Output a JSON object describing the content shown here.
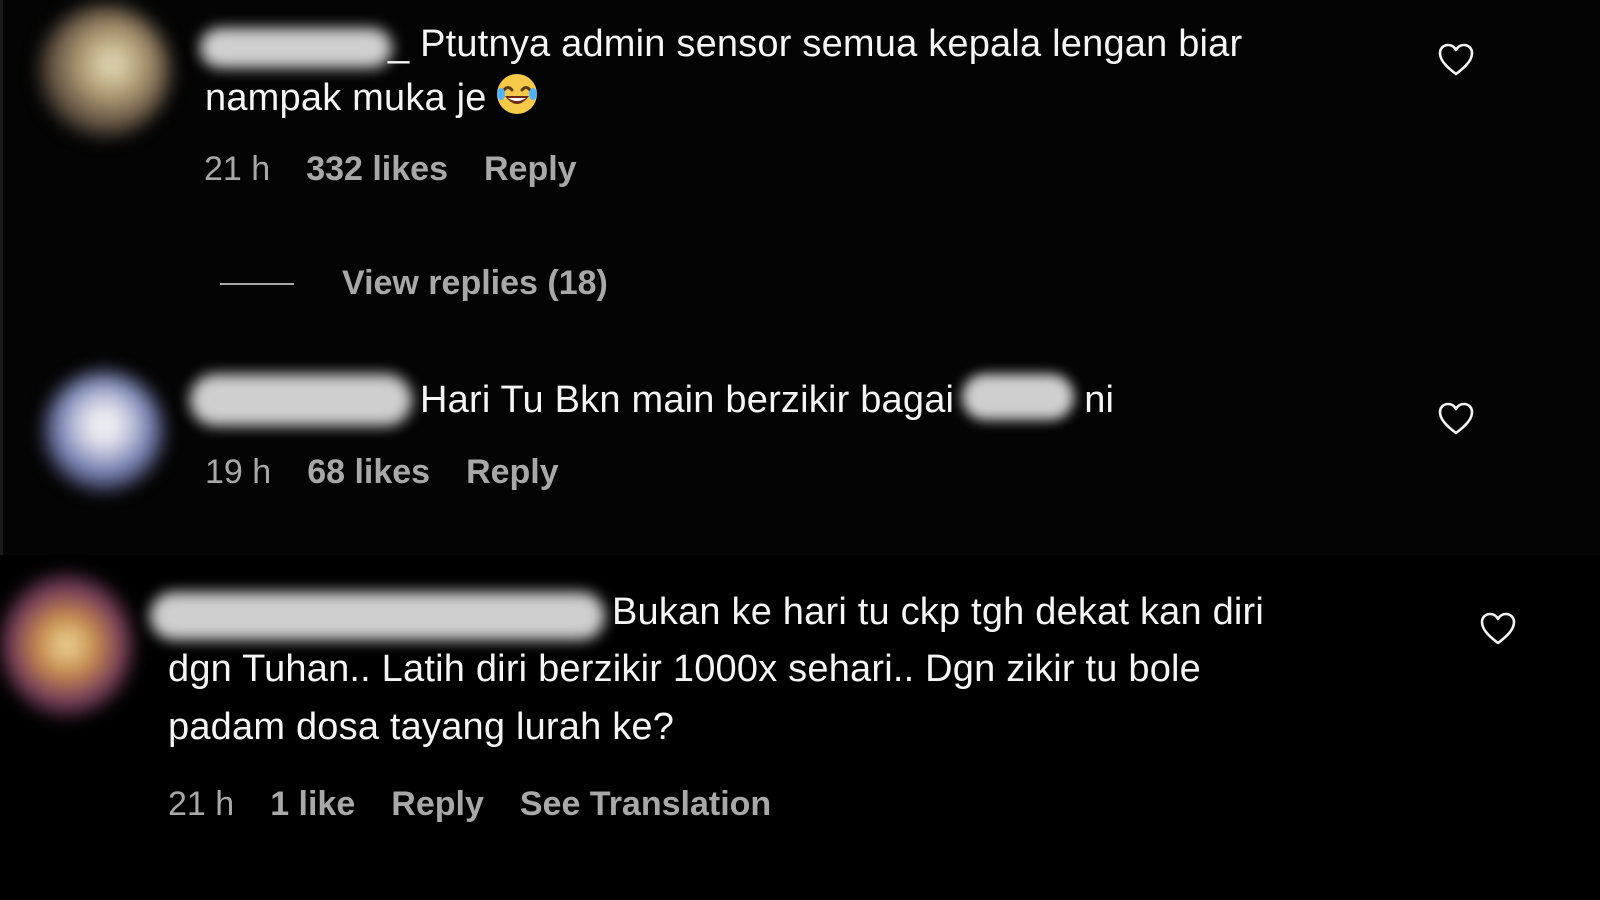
{
  "comments": [
    {
      "text_line1": "_ Ptutnya admin sensor semua kepala lengan biar",
      "text_line2": "nampak muka je",
      "emoji": "laughing-tears-emoji",
      "time": "21 h",
      "likes": "332 likes",
      "reply": "Reply",
      "view_replies": "View replies (18)",
      "heart_icon": "heart-outline-icon"
    },
    {
      "text_before": "Hari Tu Bkn main berzikir bagai",
      "text_after": "ni",
      "time": "19 h",
      "likes": "68 likes",
      "reply": "Reply",
      "heart_icon": "heart-outline-icon"
    },
    {
      "text_line1": "Bukan ke hari tu ckp tgh dekat kan diri",
      "text_line2": "dgn Tuhan.. Latih diri berzikir 1000x sehari.. Dgn zikir tu bole",
      "text_line3": "padam dosa tayang lurah ke?",
      "time": "21 h",
      "likes": "1 like",
      "reply": "Reply",
      "translation": "See Translation",
      "heart_icon": "heart-outline-icon"
    }
  ],
  "colors": {
    "background": "#000000",
    "text_primary": "#f5f5f5",
    "text_secondary": "#a8a8a8"
  }
}
